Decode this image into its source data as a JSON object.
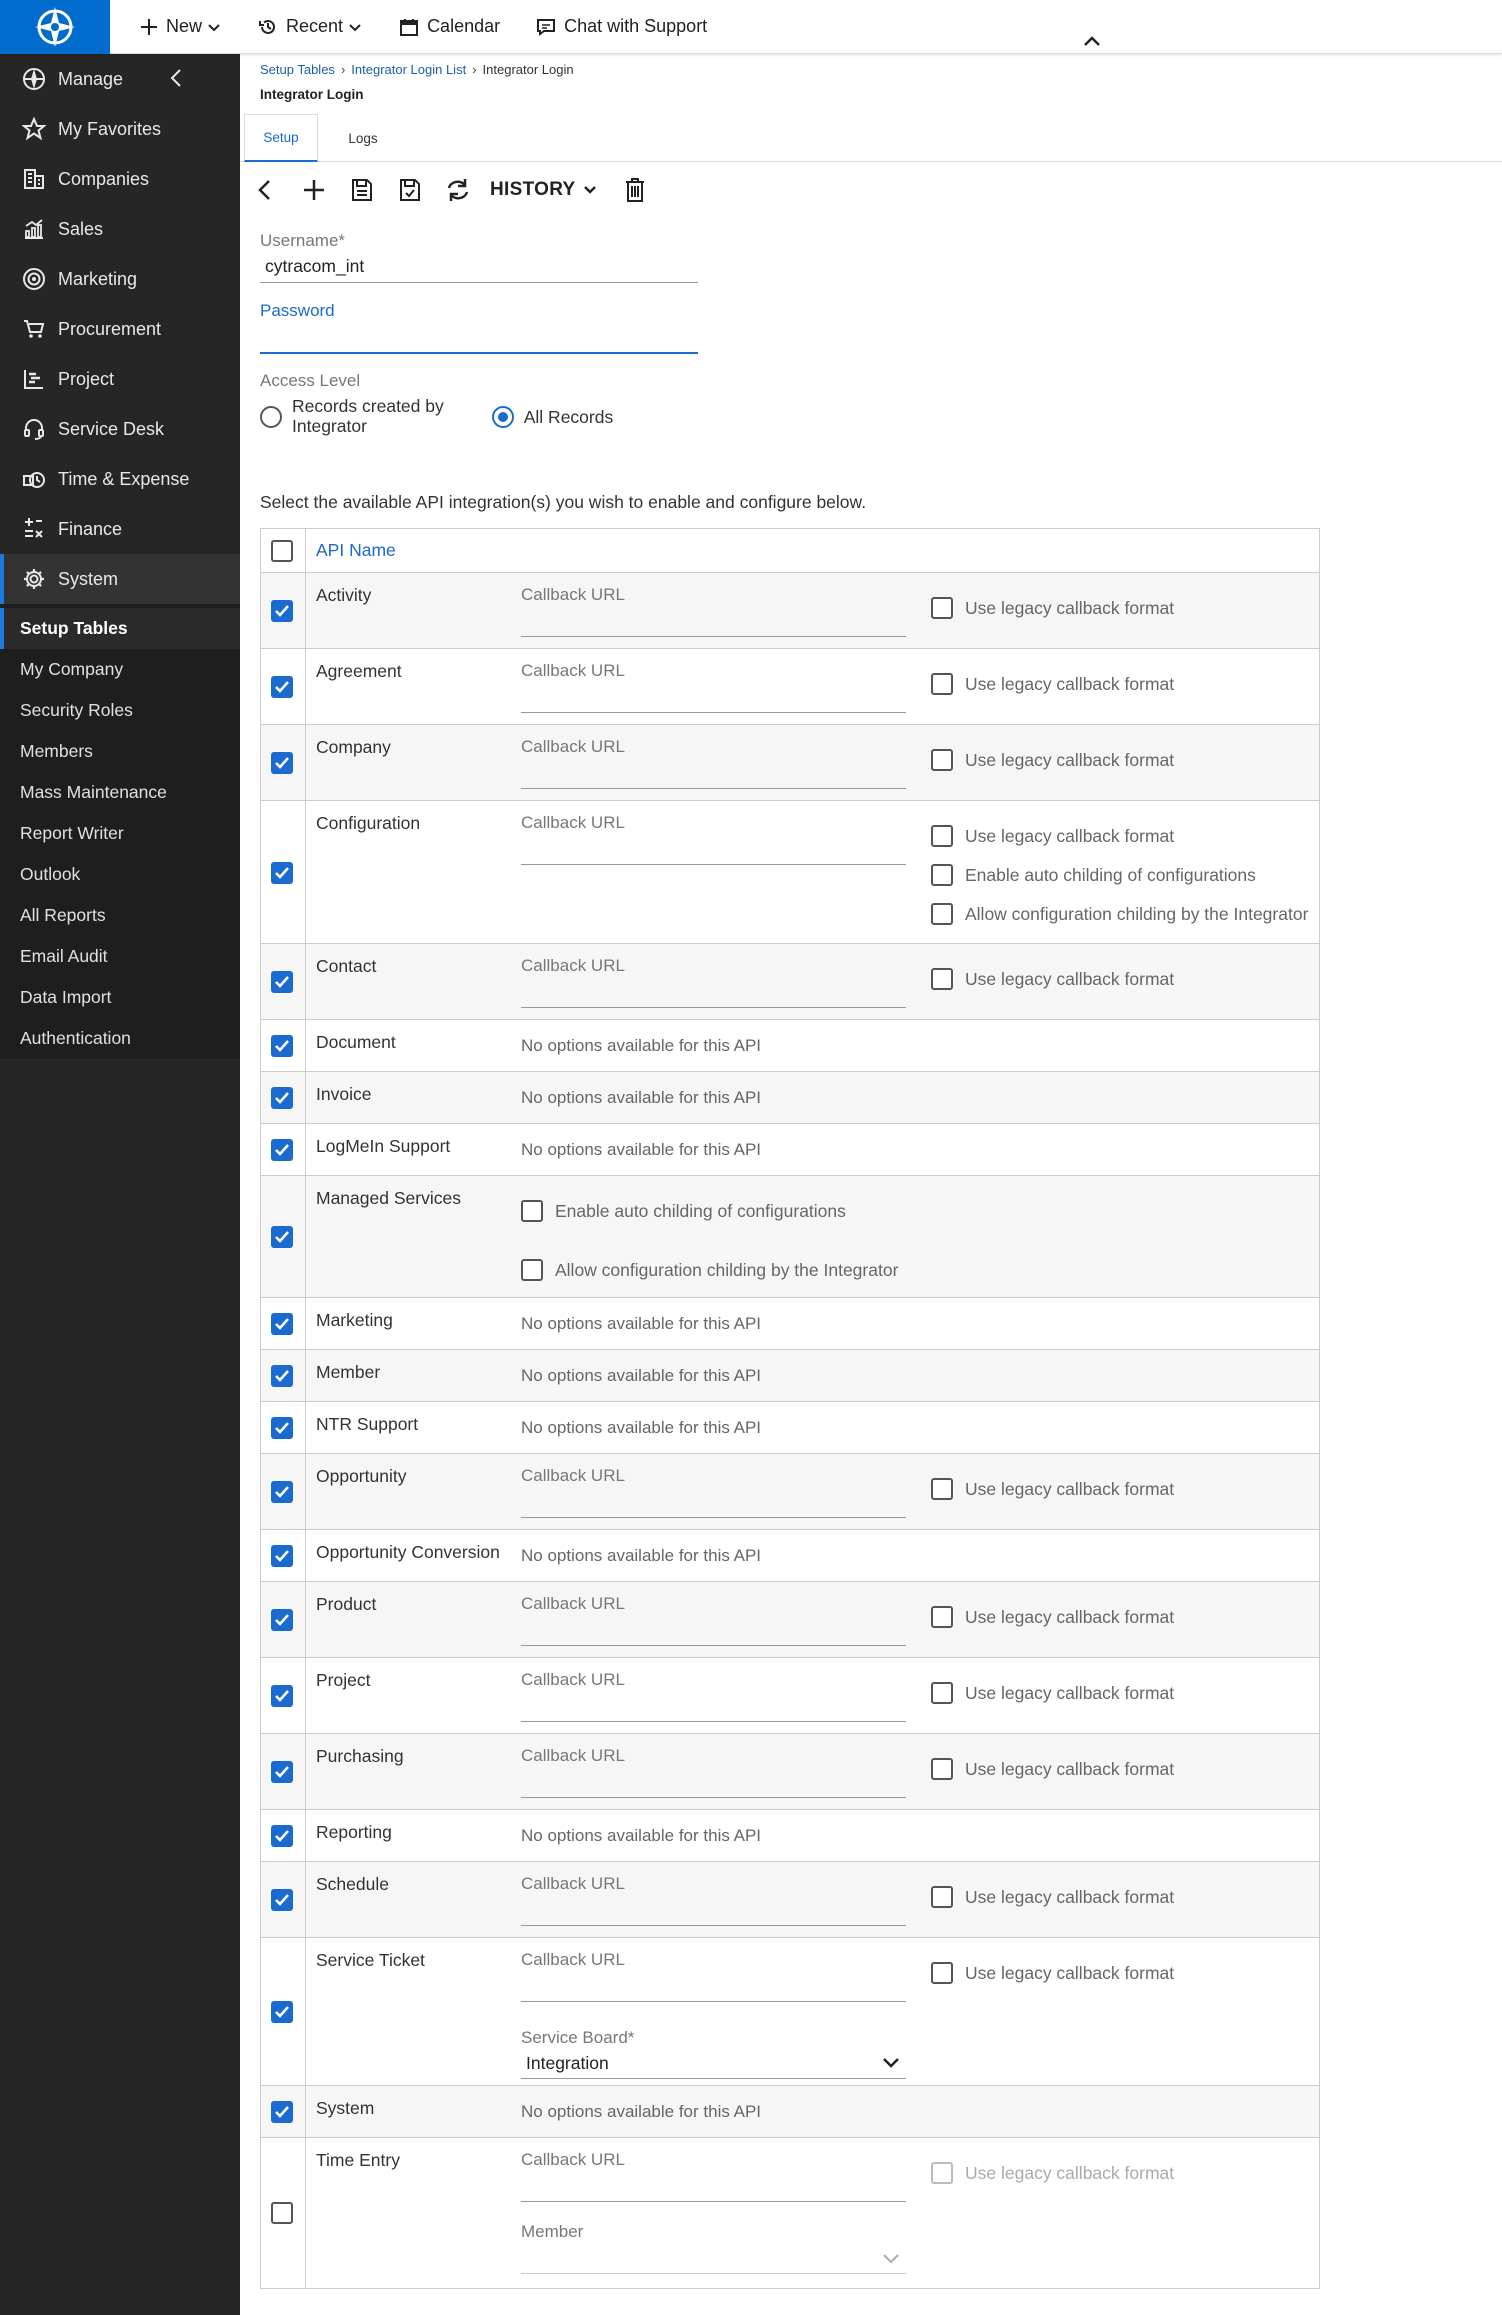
{
  "topnav": {
    "new": "New",
    "recent": "Recent",
    "calendar": "Calendar",
    "chat": "Chat with Support"
  },
  "sidebar": {
    "items": [
      {
        "label": "Manage",
        "icon": "globe-icon"
      },
      {
        "label": "My Favorites",
        "icon": "star-icon"
      },
      {
        "label": "Companies",
        "icon": "building-icon"
      },
      {
        "label": "Sales",
        "icon": "chart-icon"
      },
      {
        "label": "Marketing",
        "icon": "target-icon"
      },
      {
        "label": "Procurement",
        "icon": "cart-icon"
      },
      {
        "label": "Project",
        "icon": "gantt-icon"
      },
      {
        "label": "Service Desk",
        "icon": "headset-icon"
      },
      {
        "label": "Time & Expense",
        "icon": "clock-icon"
      },
      {
        "label": "Finance",
        "icon": "finance-icon"
      },
      {
        "label": "System",
        "icon": "gear-icon"
      }
    ],
    "sub_items": [
      "Setup Tables",
      "My Company",
      "Security Roles",
      "Members",
      "Mass Maintenance",
      "Report Writer",
      "Outlook",
      "All Reports",
      "Email Audit",
      "Data Import",
      "Authentication"
    ]
  },
  "breadcrumb": {
    "a": "Setup Tables",
    "b": "Integrator Login List",
    "c": "Integrator Login"
  },
  "page_title": "Integrator Login",
  "tabs": {
    "setup": "Setup",
    "logs": "Logs"
  },
  "toolbar": {
    "history": "HISTORY"
  },
  "form": {
    "username_label": "Username*",
    "username_value": "cytracom_int",
    "password_label": "Password",
    "access_label": "Access Level",
    "access_option_1_line1": "Records created by",
    "access_option_1_line2": "Integrator",
    "access_option_2": "All Records",
    "intro": "Select the available API integration(s) you wish to enable and configure below."
  },
  "table": {
    "header": "API Name",
    "callback_label": "Callback URL",
    "legacy_label": "Use legacy callback format",
    "no_options": "No options available for this API",
    "auto_child": "Enable auto childing of configurations",
    "allow_child": "Allow configuration childing by the Integrator",
    "service_board_label": "Service Board*",
    "service_board_value": "Integration",
    "member_label": "Member",
    "rows": [
      {
        "name": "Activity",
        "type": "callback",
        "checked": true
      },
      {
        "name": "Agreement",
        "type": "callback",
        "checked": true
      },
      {
        "name": "Company",
        "type": "callback",
        "checked": true
      },
      {
        "name": "Configuration",
        "type": "config",
        "checked": true
      },
      {
        "name": "Contact",
        "type": "callback",
        "checked": true
      },
      {
        "name": "Document",
        "type": "none",
        "checked": true
      },
      {
        "name": "Invoice",
        "type": "none",
        "checked": true
      },
      {
        "name": "LogMeIn Support",
        "type": "none",
        "checked": true
      },
      {
        "name": "Managed Services",
        "type": "managed",
        "checked": true
      },
      {
        "name": "Marketing",
        "type": "none",
        "checked": true
      },
      {
        "name": "Member",
        "type": "none",
        "checked": true
      },
      {
        "name": "NTR Support",
        "type": "none",
        "checked": true
      },
      {
        "name": "Opportunity",
        "type": "callback",
        "checked": true
      },
      {
        "name": "Opportunity Conversion",
        "type": "none",
        "checked": true
      },
      {
        "name": "Product",
        "type": "callback",
        "checked": true
      },
      {
        "name": "Project",
        "type": "callback",
        "checked": true
      },
      {
        "name": "Purchasing",
        "type": "callback",
        "checked": true
      },
      {
        "name": "Reporting",
        "type": "none",
        "checked": true
      },
      {
        "name": "Schedule",
        "type": "callback",
        "checked": true
      },
      {
        "name": "Service Ticket",
        "type": "ticket",
        "checked": true
      },
      {
        "name": "System",
        "type": "none",
        "checked": true
      },
      {
        "name": "Time Entry",
        "type": "time",
        "checked": false
      }
    ]
  },
  "colors": {
    "accent": "#1a6ad0",
    "sidebar": "#262626",
    "logo": "#026cce"
  }
}
